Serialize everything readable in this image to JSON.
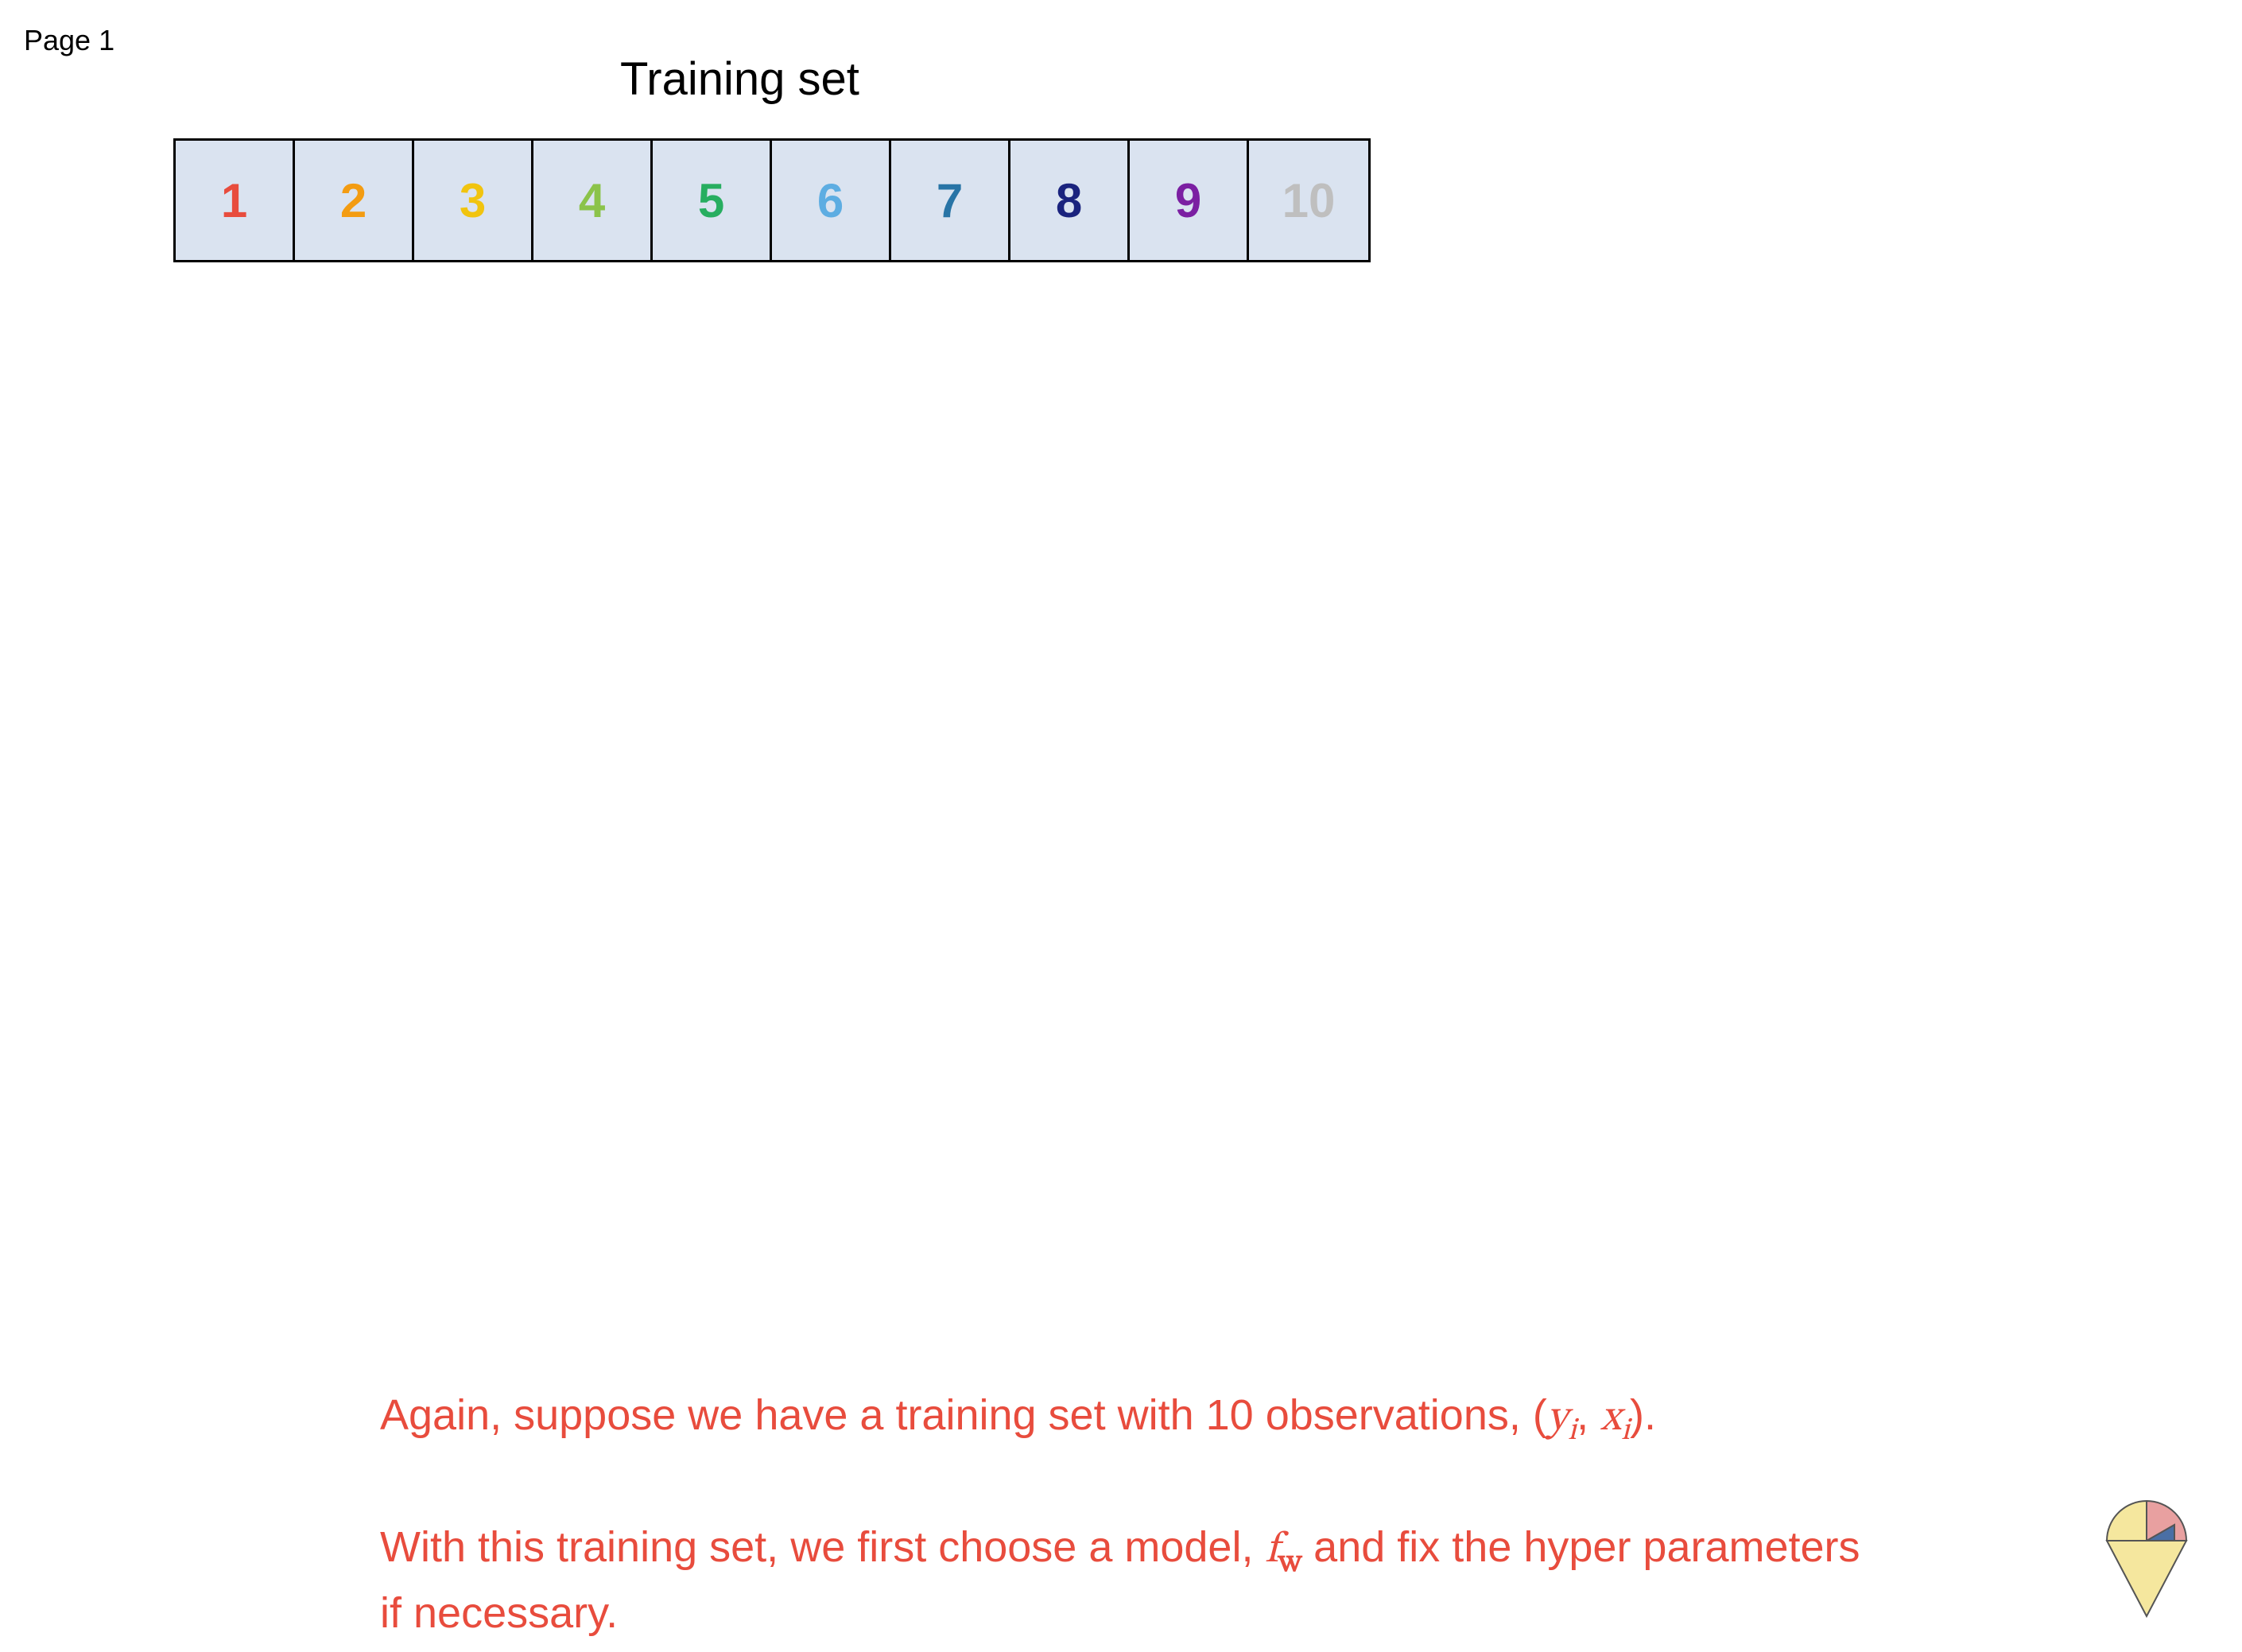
{
  "page_label": "Page 1",
  "title": "Training set",
  "cells": [
    {
      "value": "1",
      "color": "#e84c3d"
    },
    {
      "value": "2",
      "color": "#f39c12"
    },
    {
      "value": "3",
      "color": "#f1c40f"
    },
    {
      "value": "4",
      "color": "#8bc34a"
    },
    {
      "value": "5",
      "color": "#27ae60"
    },
    {
      "value": "6",
      "color": "#5dade2"
    },
    {
      "value": "7",
      "color": "#2874a6"
    },
    {
      "value": "8",
      "color": "#1a237e"
    },
    {
      "value": "9",
      "color": "#7b1fa2"
    },
    {
      "value": "10",
      "color": "#bfbfbf"
    }
  ],
  "body": {
    "line1_pre": "Again, suppose we have a training set with 10 observations, (",
    "line1_y": "y",
    "line1_sub1": "i",
    "line1_comma": ", ",
    "line1_x": "x",
    "line1_sub2": "i",
    "line1_post": ").",
    "line2_pre": "With this training set, we first choose a model, ",
    "line2_f": "f",
    "line2_sub": "w",
    "line2_post": " and fix the hyper parameters if necessary."
  }
}
